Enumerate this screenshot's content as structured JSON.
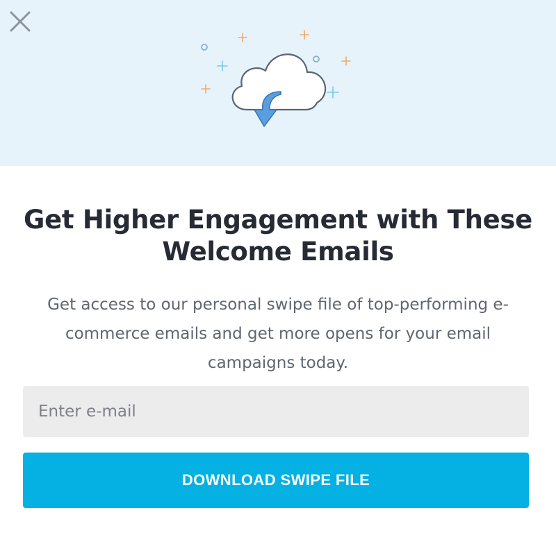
{
  "modal": {
    "close_icon": "close-icon",
    "illustration_icon": "cloud-download-icon",
    "headline": "Get Higher Engagement with These Welcome Emails",
    "subtext": "Get access to our personal swipe file of top-performing e-commerce emails and get more opens for your email campaigns today.",
    "email_placeholder": "Enter e-mail",
    "email_value": "",
    "download_label": "DOWNLOAD SWIPE FILE"
  },
  "colors": {
    "hero_background": "#e6f3fb",
    "headline": "#262b36",
    "subtext": "#5f6670",
    "input_background": "#ececed",
    "button_background": "#04b1e2",
    "button_text": "#ffffff",
    "cloud_arrow": "#4a90d9",
    "sparkle_orange": "#f0a868",
    "sparkle_blue": "#7cc6e8"
  }
}
